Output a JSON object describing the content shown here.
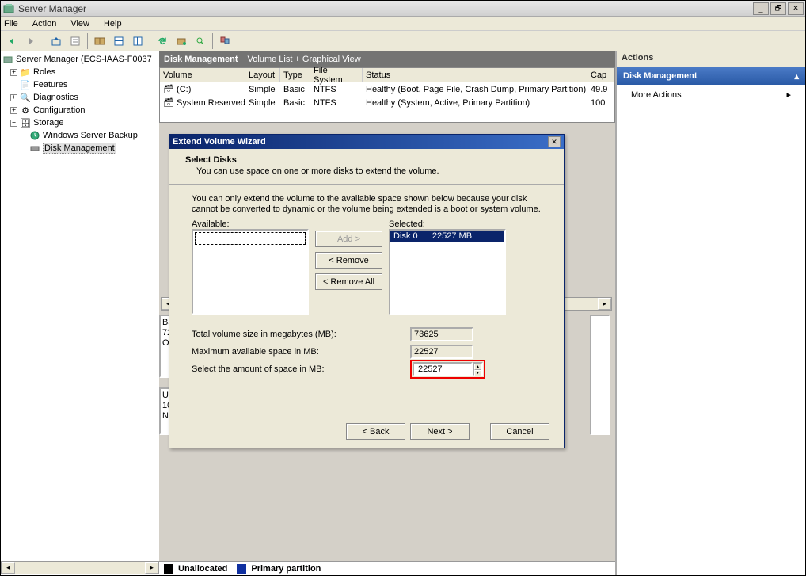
{
  "window": {
    "title": "Server Manager"
  },
  "menu": {
    "file": "File",
    "action": "Action",
    "view": "View",
    "help": "Help"
  },
  "tree": {
    "root": "Server Manager (ECS-IAAS-F0037",
    "roles": "Roles",
    "features": "Features",
    "diagnostics": "Diagnostics",
    "configuration": "Configuration",
    "storage": "Storage",
    "wsb": "Windows Server Backup",
    "dm": "Disk Management"
  },
  "center": {
    "title": "Disk Management",
    "subtitle": "Volume List + Graphical View"
  },
  "grid": {
    "headers": {
      "volume": "Volume",
      "layout": "Layout",
      "type": "Type",
      "fs": "File System",
      "status": "Status",
      "cap": "Cap"
    },
    "rows": [
      {
        "vol": "(C:)",
        "layout": "Simple",
        "type": "Basic",
        "fs": "NTFS",
        "status": "Healthy (Boot, Page File, Crash Dump, Primary Partition)",
        "cap": "49.9"
      },
      {
        "vol": "System Reserved",
        "layout": "Simple",
        "type": "Basic",
        "fs": "NTFS",
        "status": "Healthy (System, Active, Primary Partition)",
        "cap": "100"
      }
    ]
  },
  "actions": {
    "head": "Actions",
    "sect": "Disk Management",
    "more": "More Actions"
  },
  "wizard": {
    "title": "Extend Volume Wizard",
    "h": "Select Disks",
    "sub": "You can use space on one or more disks to extend the volume.",
    "msg": "You can only extend the volume to the available space shown below because your disk cannot be converted to dynamic or the volume being extended is a boot or system volume.",
    "available": "Available:",
    "selected": "Selected:",
    "selitem": "Disk 0      22527 MB",
    "add": "Add >",
    "remove": "< Remove",
    "removeall": "< Remove All",
    "total_l": "Total volume size in megabytes (MB):",
    "total_v": "73625",
    "max_l": "Maximum available space in MB:",
    "max_v": "22527",
    "amt_l": "Select the amount of space in MB:",
    "amt_v": "22527",
    "back": "< Back",
    "next": "Next >",
    "cancel": "Cancel"
  },
  "legend": {
    "unalloc": "Unallocated",
    "primary": "Primary partition"
  },
  "partial": {
    "ba": "Ba",
    "n72": "72",
    "o": "O",
    "u": "U",
    "n10": "10",
    "n": "N"
  }
}
